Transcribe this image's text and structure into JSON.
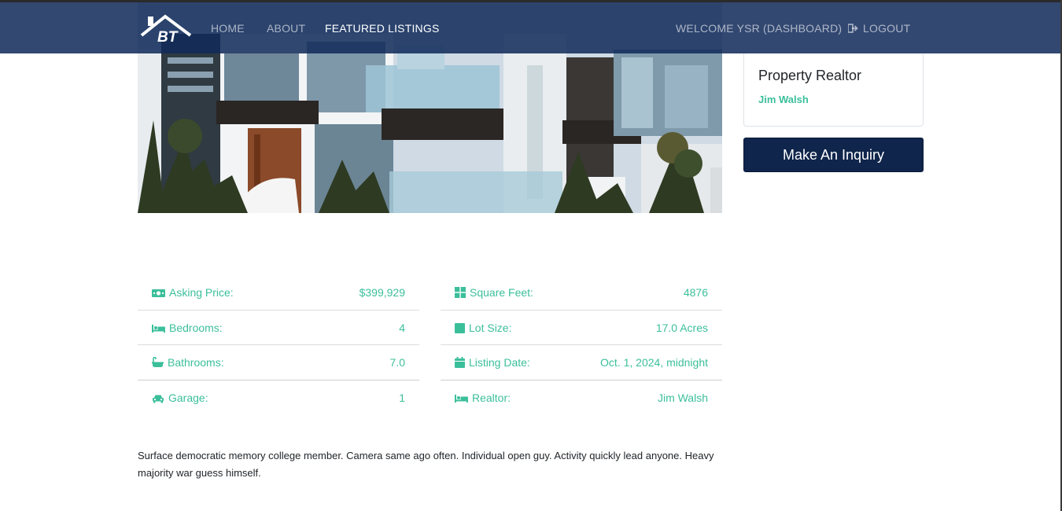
{
  "nav": {
    "brand_text": "BT",
    "links": [
      "HOME",
      "ABOUT",
      "FEATURED LISTINGS"
    ],
    "welcome": "WELCOME YSR (DASHBOARD)",
    "logout": "LOGOUT"
  },
  "sidebar": {
    "card_title": "Property Realtor",
    "realtor_name": "Jim Walsh",
    "inquiry_button": "Make An Inquiry"
  },
  "details_left": [
    {
      "icon": "money-icon",
      "label": "Asking Price:",
      "value": "$399,929"
    },
    {
      "icon": "bed-icon",
      "label": "Bedrooms:",
      "value": "4"
    },
    {
      "icon": "bath-icon",
      "label": "Bathrooms:",
      "value": "7.0"
    },
    {
      "icon": "car-icon",
      "label": "Garage:",
      "value": "1"
    }
  ],
  "details_right": [
    {
      "icon": "grid-icon",
      "label": "Square Feet:",
      "value": "4876"
    },
    {
      "icon": "square-icon",
      "label": "Lot Size:",
      "value": "17.0 Acres"
    },
    {
      "icon": "calendar-icon",
      "label": "Listing Date:",
      "value": "Oct. 1, 2024, midnight"
    },
    {
      "icon": "bed-icon",
      "label": "Realtor:",
      "value": "Jim Walsh"
    }
  ],
  "description": "Surface democratic memory college member. Camera same ago often. Individual open guy. Activity quickly lead anyone. Heavy majority war guess himself.",
  "colors": {
    "navbar": "#102a5a",
    "accent": "#3bbf9b",
    "button": "#10254b"
  }
}
